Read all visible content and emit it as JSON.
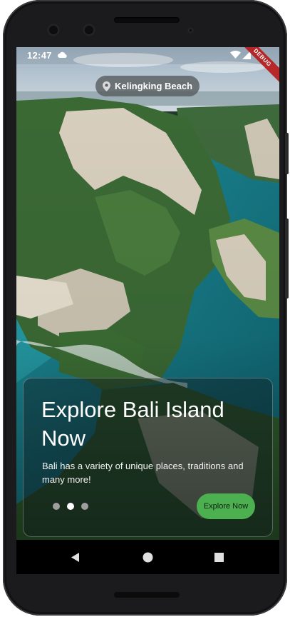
{
  "status_bar": {
    "time": "12:47",
    "icons": [
      "cloud-icon",
      "wifi-icon",
      "cell-signal-icon"
    ],
    "debug_banner": "DEBUG"
  },
  "location": {
    "icon": "location-pin-icon",
    "label": "Kelingking Beach"
  },
  "card": {
    "title": "Explore Bali Island Now",
    "description": "Bali has a variety of unique places, traditions and many more!",
    "page_indicator": {
      "count": 3,
      "active_index": 1
    },
    "cta_label": "Explore Now"
  },
  "nav_bar": {
    "icons": [
      "back-icon",
      "home-icon",
      "recents-icon"
    ]
  },
  "colors": {
    "accent": "#4caf50",
    "debug_banner": "#b71c1c",
    "device_frame": "#1b1b1d"
  }
}
